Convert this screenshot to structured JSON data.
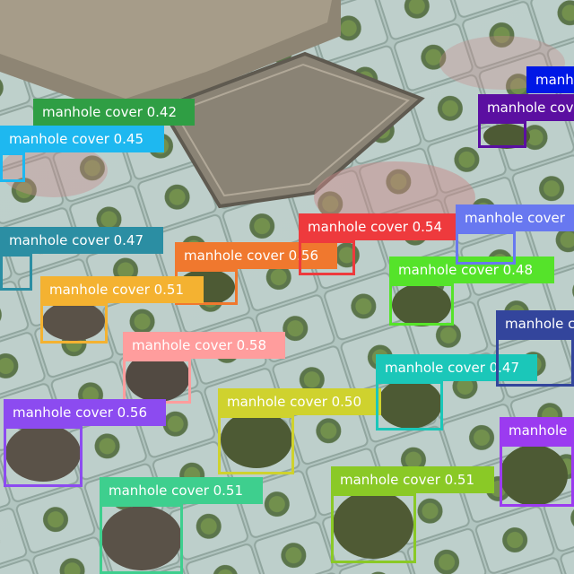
{
  "class_label": "manhole cover",
  "detections": [
    {
      "label": "manhole cover 0.42",
      "color": "#2f9e44"
    },
    {
      "label": "manhole cover 0.45",
      "color": "#1eb8f0"
    },
    {
      "label": "manhole cover 0.47",
      "color": "#2b8ea3"
    },
    {
      "label": "manhole cover 0.56",
      "color": "#f0782e"
    },
    {
      "label": "manhole cover 0.51",
      "color": "#f4b231"
    },
    {
      "label": "manhole cover 0.54",
      "color": "#ee3a3d"
    },
    {
      "label": "manhole cover 0.48",
      "color": "#55e32a"
    },
    {
      "label": "manhole cover 0.58",
      "color": "#ff9d9d"
    },
    {
      "label": "manhole cover 0.56",
      "color": "#8c4bf0"
    },
    {
      "label": "manhole cover 0.50",
      "color": "#cfd22e"
    },
    {
      "label": "manhole cover 0.47",
      "color": "#1bc7b9"
    },
    {
      "label": "manhole cover 0.51",
      "color": "#3ecf8e"
    },
    {
      "label": "manhole cover 0.51",
      "color": "#8ac926"
    },
    {
      "label": "manhole",
      "color": "#0018e6"
    },
    {
      "label": "manhole cover",
      "color": "#5b0fa1"
    },
    {
      "label": "manhole cover",
      "color": "#6878f0"
    },
    {
      "label": "manhole c",
      "color": "#33459c"
    },
    {
      "label": "manhole",
      "color": "#9b3bf0"
    }
  ]
}
